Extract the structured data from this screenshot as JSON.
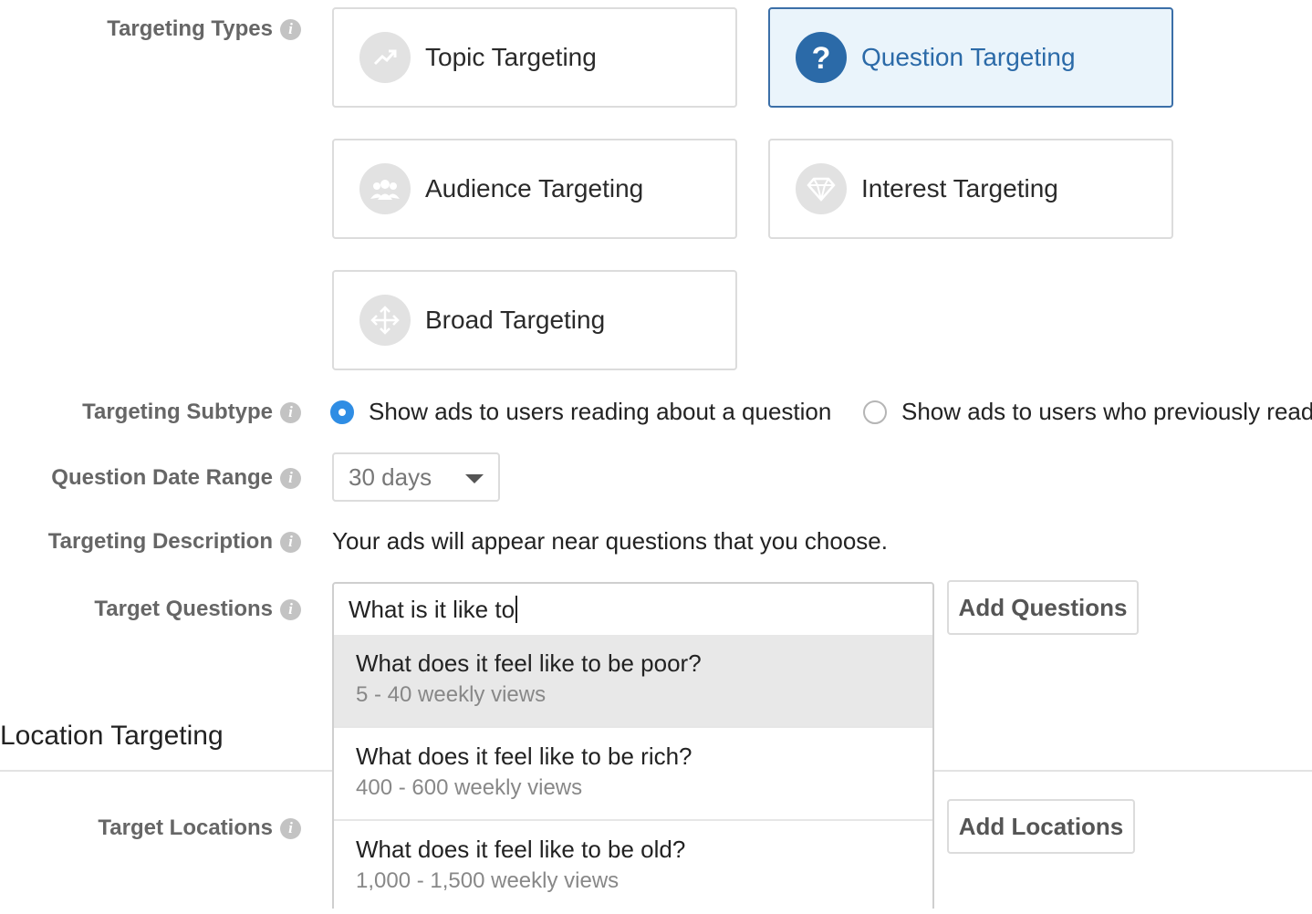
{
  "labels": {
    "targeting_types": "Targeting Types",
    "targeting_subtype": "Targeting Subtype",
    "question_date_range": "Question Date Range",
    "targeting_description": "Targeting Description",
    "target_questions": "Target Questions",
    "target_locations": "Target Locations",
    "info_glyph": "i"
  },
  "targeting_types": [
    {
      "label": "Topic Targeting",
      "icon": "trending-icon",
      "selected": false
    },
    {
      "label": "Question Targeting",
      "icon": "question-icon",
      "selected": true
    },
    {
      "label": "Audience Targeting",
      "icon": "group-icon",
      "selected": false
    },
    {
      "label": "Interest Targeting",
      "icon": "diamond-icon",
      "selected": false
    },
    {
      "label": "Broad Targeting",
      "icon": "move-arrows-icon",
      "selected": false
    }
  ],
  "subtype": {
    "options": [
      {
        "label": "Show ads to users reading about a question",
        "selected": true
      },
      {
        "label": "Show ads to users who previously read",
        "selected": false
      }
    ]
  },
  "date_range": {
    "value": "30 days"
  },
  "description": "Your ads will appear near questions that you choose.",
  "questions_input": {
    "value": "What is it like to"
  },
  "add_questions_label": "Add Questions",
  "suggestions": [
    {
      "question": "What does it feel like to be poor?",
      "views": "5 - 40 weekly views",
      "highlighted": true
    },
    {
      "question": "What does it feel like to be rich?",
      "views": "400 - 600 weekly views",
      "highlighted": false
    },
    {
      "question": "What does it feel like to be old?",
      "views": "1,000 - 1,500 weekly views",
      "highlighted": false
    }
  ],
  "location_section_title": "Location Targeting",
  "add_locations_label": "Add Locations",
  "colors": {
    "accent": "#2b6aa8",
    "selected_bg": "#eaf4fb",
    "radio_on": "#2f8de4"
  }
}
